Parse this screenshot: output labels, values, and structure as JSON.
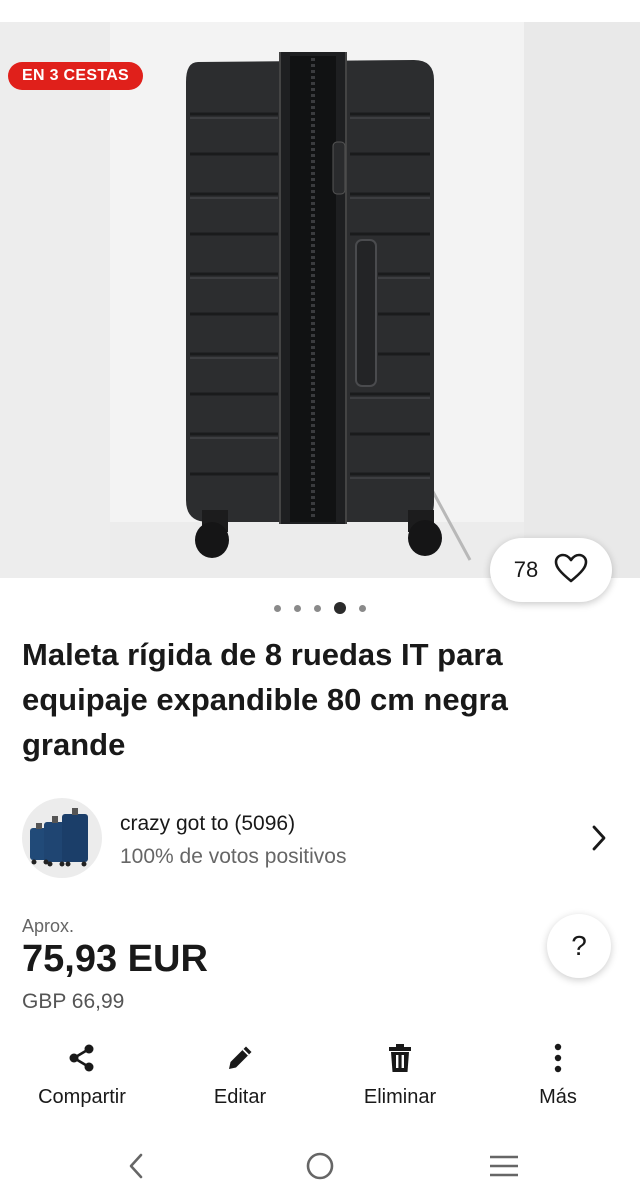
{
  "product": {
    "badge": "EN 3 CESTAS",
    "watch_count": "78",
    "image_dots": {
      "count": 5,
      "active_index": 3
    },
    "title": "Maleta rígida de 8 ruedas IT para equipaje expandible 80 cm negra grande"
  },
  "seller": {
    "name": "crazy got to (5096)",
    "feedback": "100% de votos positivos"
  },
  "price": {
    "approx_label": "Aprox.",
    "converted": "75,93 EUR",
    "original": "GBP 66,99"
  },
  "help": {
    "label": "?"
  },
  "actions": [
    {
      "icon": "share-icon",
      "label": "Compartir"
    },
    {
      "icon": "pencil-icon",
      "label": "Editar"
    },
    {
      "icon": "trash-icon",
      "label": "Eliminar"
    },
    {
      "icon": "more-vertical-icon",
      "label": "Más"
    }
  ],
  "system_nav": [
    "back-icon",
    "home-icon",
    "recents-icon"
  ],
  "colors": {
    "badge_red": "#e0201b",
    "text": "#191919",
    "muted": "#666666"
  }
}
